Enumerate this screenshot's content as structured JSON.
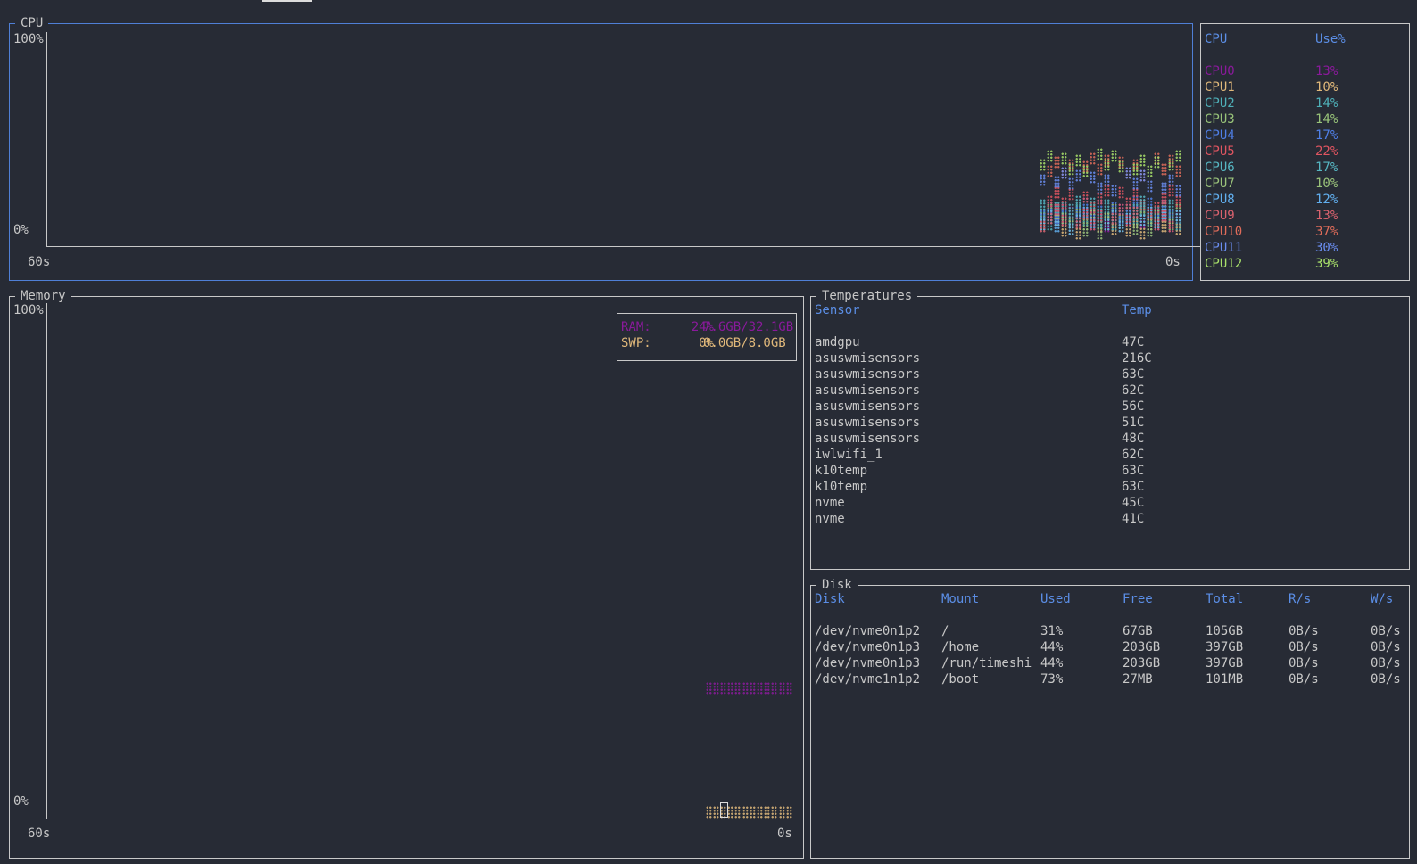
{
  "colors": {
    "background": "#272b35",
    "border": "#c8c8c8",
    "focused_border": "#4f7fd6",
    "header": "#5b8ee6",
    "text": "#c8c8c8"
  },
  "cpu": {
    "title": "CPU",
    "y_max_label": "100%",
    "y_min_label": "0%",
    "x_start_label": "60s",
    "x_end_label": "0s",
    "table": {
      "headers": [
        "CPU",
        "Use%"
      ],
      "rows": [
        {
          "name": "CPU0",
          "use": "13%",
          "color": "#8a1a9b"
        },
        {
          "name": "CPU1",
          "use": "10%",
          "color": "#e0b87a"
        },
        {
          "name": "CPU2",
          "use": "14%",
          "color": "#4fb0b8"
        },
        {
          "name": "CPU3",
          "use": "14%",
          "color": "#98c379"
        },
        {
          "name": "CPU4",
          "use": "17%",
          "color": "#4f7fe6"
        },
        {
          "name": "CPU5",
          "use": "22%",
          "color": "#e05561"
        },
        {
          "name": "CPU6",
          "use": "17%",
          "color": "#56b6c2"
        },
        {
          "name": "CPU7",
          "use": "10%",
          "color": "#9ac27a"
        },
        {
          "name": "CPU8",
          "use": "12%",
          "color": "#61afef"
        },
        {
          "name": "CPU9",
          "use": "13%",
          "color": "#d9626e"
        },
        {
          "name": "CPU10",
          "use": "37%",
          "color": "#e06c5a"
        },
        {
          "name": "CPU11",
          "use": "30%",
          "color": "#6a8df0"
        },
        {
          "name": "CPU12",
          "use": "39%",
          "color": "#a8e06a"
        }
      ]
    }
  },
  "memory": {
    "title": "Memory",
    "y_max_label": "100%",
    "y_min_label": "0%",
    "x_start_label": "60s",
    "x_end_label": "0s",
    "legend": [
      {
        "label": "RAM:",
        "percent": "24%",
        "usage": "7.6GB/32.1GB",
        "color": "#8a1a9b",
        "value_pct": 24
      },
      {
        "label": "SWP:",
        "percent": "0%",
        "usage": "0.0GB/8.0GB",
        "color": "#e0b87a",
        "value_pct": 0
      }
    ]
  },
  "temperatures": {
    "title": "Temperatures",
    "headers": [
      "Sensor",
      "Temp"
    ],
    "rows": [
      [
        "amdgpu",
        "47C"
      ],
      [
        "asuswmisensors",
        "216C"
      ],
      [
        "asuswmisensors",
        "63C"
      ],
      [
        "asuswmisensors",
        "62C"
      ],
      [
        "asuswmisensors",
        "56C"
      ],
      [
        "asuswmisensors",
        "51C"
      ],
      [
        "asuswmisensors",
        "48C"
      ],
      [
        "iwlwifi_1",
        "62C"
      ],
      [
        "k10temp",
        "63C"
      ],
      [
        "k10temp",
        "63C"
      ],
      [
        "nvme",
        "45C"
      ],
      [
        "nvme",
        "41C"
      ]
    ]
  },
  "disk": {
    "title": "Disk",
    "headers": [
      "Disk",
      "Mount",
      "Used",
      "Free",
      "Total",
      "R/s",
      "W/s"
    ],
    "rows": [
      [
        "/dev/nvme0n1p2",
        "/",
        "31%",
        "67GB",
        "105GB",
        "0B/s",
        "0B/s"
      ],
      [
        "/dev/nvme0n1p3",
        "/home",
        "44%",
        "203GB",
        "397GB",
        "0B/s",
        "0B/s"
      ],
      [
        "/dev/nvme0n1p3",
        "/run/timeshi",
        "44%",
        "203GB",
        "397GB",
        "0B/s",
        "0B/s"
      ],
      [
        "/dev/nvme1n1p2",
        "/boot",
        "73%",
        "27MB",
        "101MB",
        "0B/s",
        "0B/s"
      ]
    ]
  }
}
